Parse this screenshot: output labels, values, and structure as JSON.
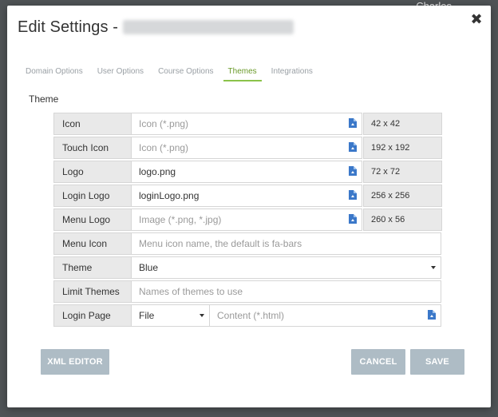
{
  "background": {
    "user_name": "Charles"
  },
  "modal": {
    "title": "Edit Settings -",
    "close_symbol": "✖"
  },
  "tabs": [
    {
      "label": "Domain Options",
      "active": false
    },
    {
      "label": "User Options",
      "active": false
    },
    {
      "label": "Course Options",
      "active": false
    },
    {
      "label": "Themes",
      "active": true
    },
    {
      "label": "Integrations",
      "active": false
    }
  ],
  "section": {
    "label": "Theme"
  },
  "rows": {
    "icon": {
      "label": "Icon",
      "value": "",
      "placeholder": "Icon (*.png)",
      "size": "42 x 42"
    },
    "touch_icon": {
      "label": "Touch Icon",
      "value": "",
      "placeholder": "Icon (*.png)",
      "size": "192 x 192"
    },
    "logo": {
      "label": "Logo",
      "value": "logo.png",
      "placeholder": "",
      "size": "72 x 72"
    },
    "login_logo": {
      "label": "Login Logo",
      "value": "loginLogo.png",
      "placeholder": "",
      "size": "256 x 256"
    },
    "menu_logo": {
      "label": "Menu Logo",
      "value": "",
      "placeholder": "Image (*.png, *.jpg)",
      "size": "260 x 56"
    },
    "menu_icon": {
      "label": "Menu Icon",
      "value": "",
      "placeholder": "Menu icon name, the default is fa-bars"
    },
    "theme": {
      "label": "Theme",
      "value": "Blue"
    },
    "limit_themes": {
      "label": "Limit Themes",
      "value": "",
      "placeholder": "Names of themes to use"
    },
    "login_page": {
      "label": "Login Page",
      "type_value": "File",
      "value": "",
      "placeholder": "Content (*.html)"
    }
  },
  "buttons": {
    "xml_editor": "XML EDITOR",
    "cancel": "CANCEL",
    "save": "SAVE"
  },
  "colors": {
    "active_tab": "#8bc34a",
    "button": "#aebcc5",
    "file_icon": "#3b78c9"
  },
  "icons": [
    "close-icon",
    "file-upload-icon",
    "dropdown-caret-icon"
  ]
}
